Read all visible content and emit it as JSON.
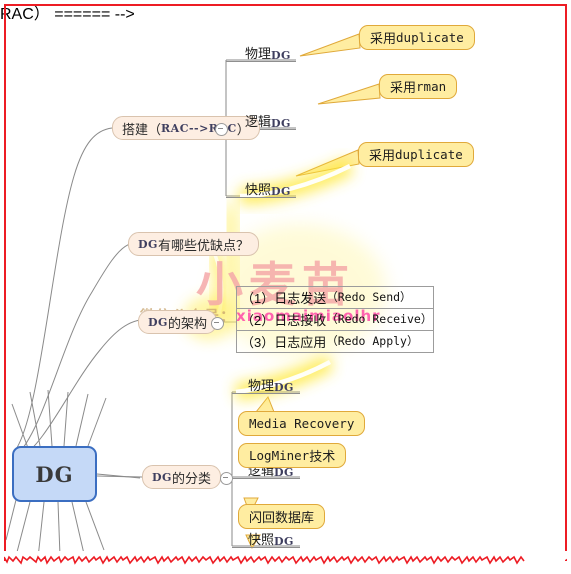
{
  "document": {
    "type": "mindmap",
    "title": "DG",
    "border_color": "#ed1c24"
  },
  "watermark": {
    "big_text": "小麦苗",
    "big_color": "#f5a9a9",
    "small_cn": "微信公众号：",
    "small_en": "xiaomaimiaolhr",
    "small_cn_color": "#c8a46e",
    "small_en_color": "#ff3ea5"
  },
  "root": {
    "label": "DG",
    "fill": "#c5d9f7",
    "stroke": "#3b6ec1"
  },
  "topics": [
    {
      "id": "build",
      "label_cn": "搭建（",
      "label_lat": "RAC-->RAC",
      "label_cn2": "）",
      "full": "搭建（RAC-->RAC）"
    },
    {
      "id": "proscons",
      "label_lat": "DG",
      "label_cn": "有哪些优缺点？",
      "full": "DG有哪些优缺点？"
    },
    {
      "id": "arch",
      "label_lat": "DG",
      "label_cn": "的架构",
      "full": "DG的架构"
    },
    {
      "id": "class",
      "label_lat": "DG",
      "label_cn": "的分类",
      "full": "DG的分类"
    }
  ],
  "build_branch": {
    "leaves": [
      {
        "cn": "物理",
        "lat": "DG",
        "full": "物理DG"
      },
      {
        "cn": "逻辑",
        "lat": "DG",
        "full": "逻辑DG"
      },
      {
        "cn": "快照",
        "lat": "DG",
        "full": "快照DG"
      }
    ],
    "callouts": [
      {
        "cn": "采用",
        "mono": "duplicate",
        "full": "采用duplicate"
      },
      {
        "cn": "采用",
        "mono": "rman",
        "full": "采用rman"
      },
      {
        "cn": "采用",
        "mono": "duplicate",
        "full": "采用duplicate"
      }
    ]
  },
  "arch_branch": {
    "rows": [
      {
        "num": "（1）",
        "cn": "日志发送",
        "mono": "（Redo Send）",
        "full": "（1）日志发送（Redo Send）"
      },
      {
        "num": "（2）",
        "cn": "日志接收",
        "mono": "（Redo Receive）",
        "full": "（2）日志接收（Redo Receive）"
      },
      {
        "num": "（3）",
        "cn": "日志应用",
        "mono": "（Redo Apply）",
        "full": "（3）日志应用（Redo Apply）"
      }
    ]
  },
  "class_branch": {
    "leaves": [
      {
        "cn": "物理",
        "lat": "DG",
        "full": "物理DG"
      },
      {
        "cn": "逻辑",
        "lat": "DG",
        "full": "逻辑DG"
      },
      {
        "cn": "快照",
        "lat": "DG",
        "full": "快照DG"
      }
    ],
    "callouts": [
      {
        "mono": "Media Recovery",
        "cn": "",
        "full": "Media Recovery"
      },
      {
        "mono": "LogMiner",
        "cn": "技术",
        "full": "LogMiner技术"
      },
      {
        "mono": "",
        "cn": "闪回数据库",
        "full": "闪回数据库"
      }
    ]
  },
  "colors": {
    "topic_fill": "#fdeee2",
    "topic_stroke": "#d9c3ae",
    "callout_fill": "#ffeda1",
    "callout_stroke": "#e0a93a",
    "wire": "#8a8a8a",
    "glow": "#ffee55"
  }
}
